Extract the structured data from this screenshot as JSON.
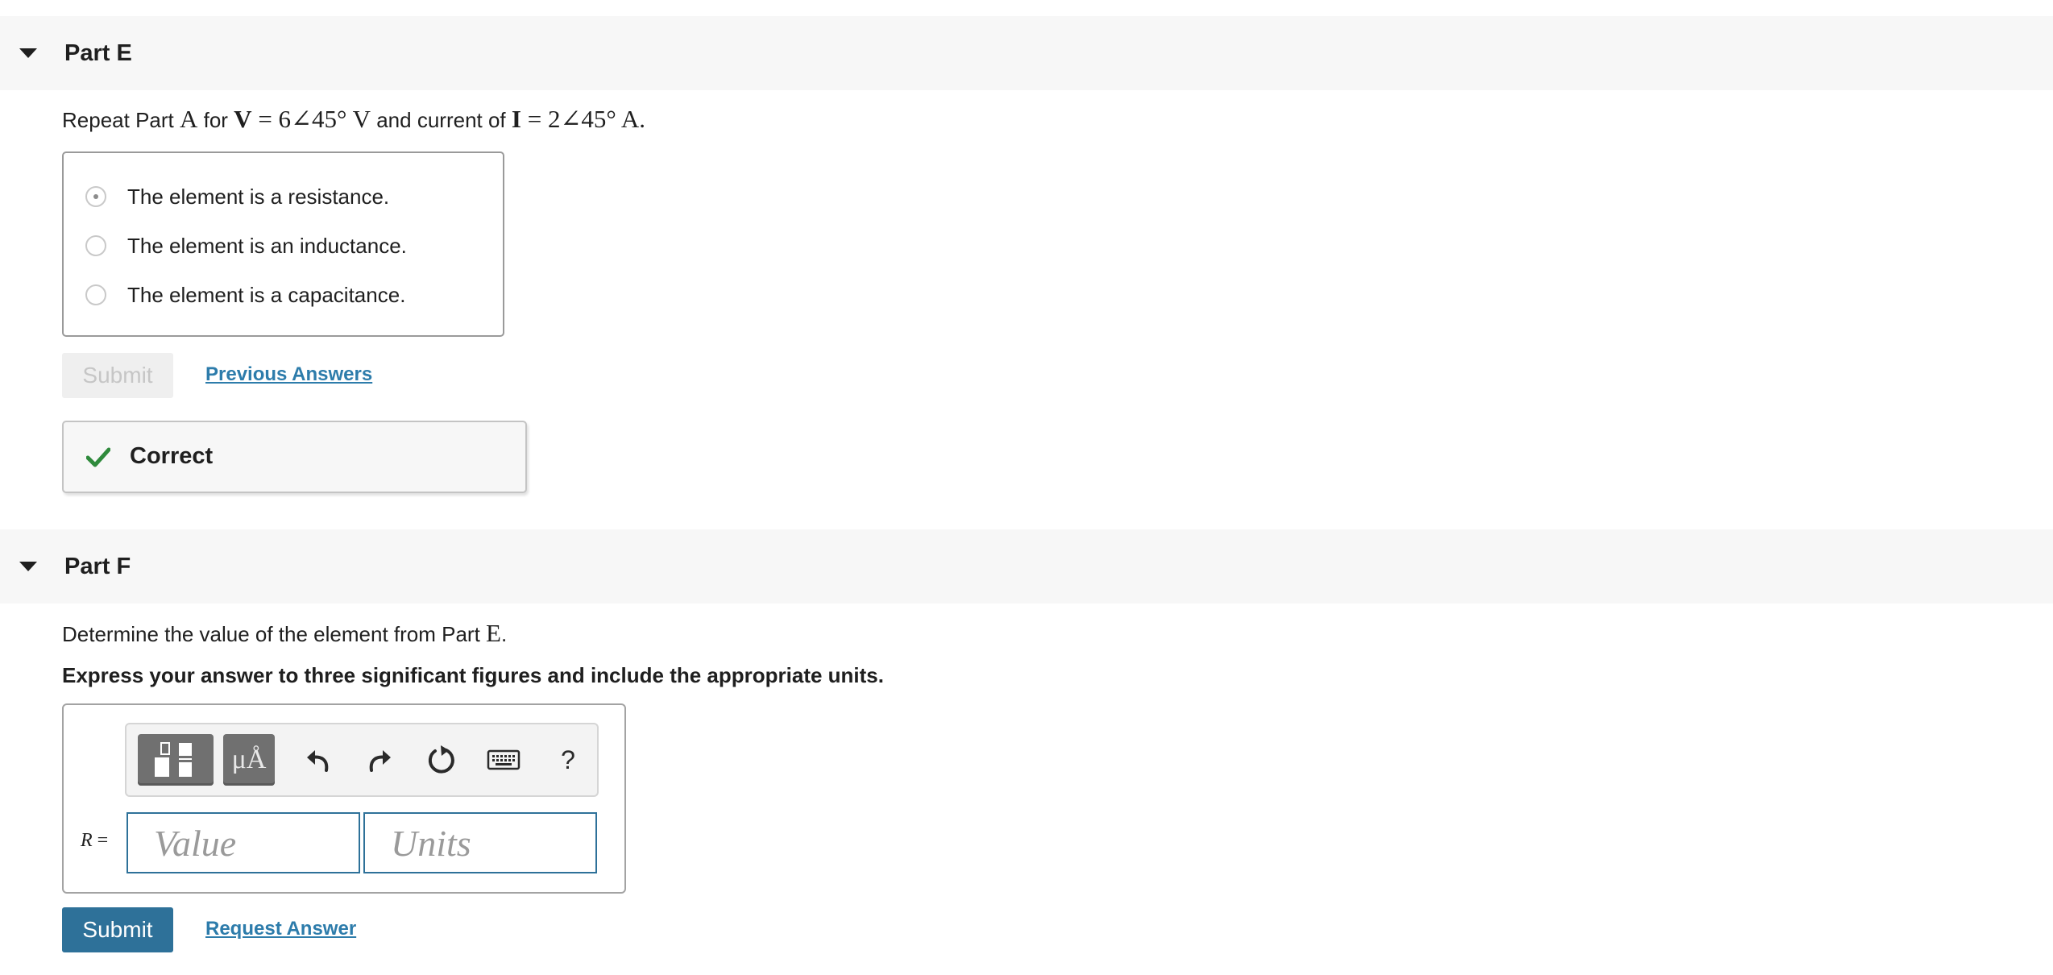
{
  "partE": {
    "title": "Part E",
    "prompt": {
      "t1": "Repeat Part ",
      "m1": "A",
      "t2": " for ",
      "v_sym": "V",
      "v_expr": " = 6∠45° V",
      "t3": " and current of ",
      "i_sym": "I",
      "i_expr": " = 2∠45° A."
    },
    "choices": [
      {
        "label": "The element is a resistance.",
        "selected": true
      },
      {
        "label": "The element is an inductance.",
        "selected": false
      },
      {
        "label": "The element is a capacitance.",
        "selected": false
      }
    ],
    "submit_label": "Submit",
    "previous_answers_label": "Previous Answers",
    "feedback": "Correct",
    "feedback_color": "#2f8a3c"
  },
  "partF": {
    "title": "Part F",
    "prompt": {
      "t1": "Determine the value of the element from Part ",
      "m1": "E",
      "t2": "."
    },
    "instruction": "Express your answer to three significant figures and include the appropriate units.",
    "toolbar": {
      "templates_icon": "fraction-template-icon",
      "units_label": "μÅ",
      "undo_icon": "undo-icon",
      "redo_icon": "redo-icon",
      "reset_icon": "reset-icon",
      "keyboard_icon": "keyboard-icon",
      "help_label": "?"
    },
    "answer_variable": "R",
    "answer_equals": " =",
    "value_placeholder": "Value",
    "units_placeholder": "Units",
    "submit_label": "Submit",
    "request_answer_label": "Request Answer",
    "accent_color": "#2e7199"
  }
}
